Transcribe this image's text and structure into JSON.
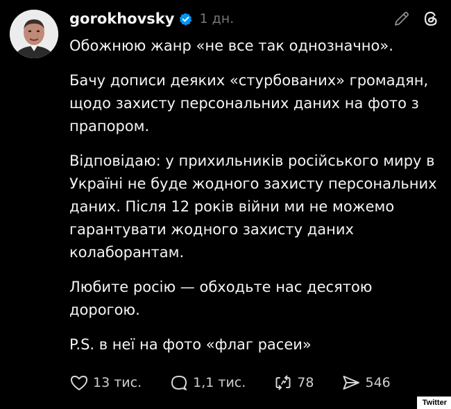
{
  "post": {
    "username": "gorokhovsky",
    "time": "1 дн.",
    "paragraphs": [
      "Обожнюю жанр «не все так однозначно».",
      "Бачу дописи деяких «стурбованих» громадян, щодо захисту персональних даних на фото з прапором.",
      "Відповідаю: у прихильників російського миру в Україні не буде жодного захисту персональних даних. Після 12 років війни ми не можемо гарантувати жодного захисту даних колаборантам.",
      "Любите росію — обходьте нас десятою дорогою.",
      "P.S. в неї на фото «флаг расеи»"
    ],
    "stats": {
      "likes": "13 тис.",
      "replies": "1,1 тис.",
      "reposts": "78",
      "shares": "546"
    }
  },
  "watermark": "Twitter",
  "colors": {
    "background": "#000000",
    "text": "#f3f5f7",
    "muted": "#777777",
    "verified": "#0095f6"
  },
  "icons": {
    "edit": "pencil-icon",
    "threads": "threads-logo-icon",
    "like": "heart-icon",
    "reply": "comment-icon",
    "repost": "repost-icon",
    "share": "send-icon"
  }
}
